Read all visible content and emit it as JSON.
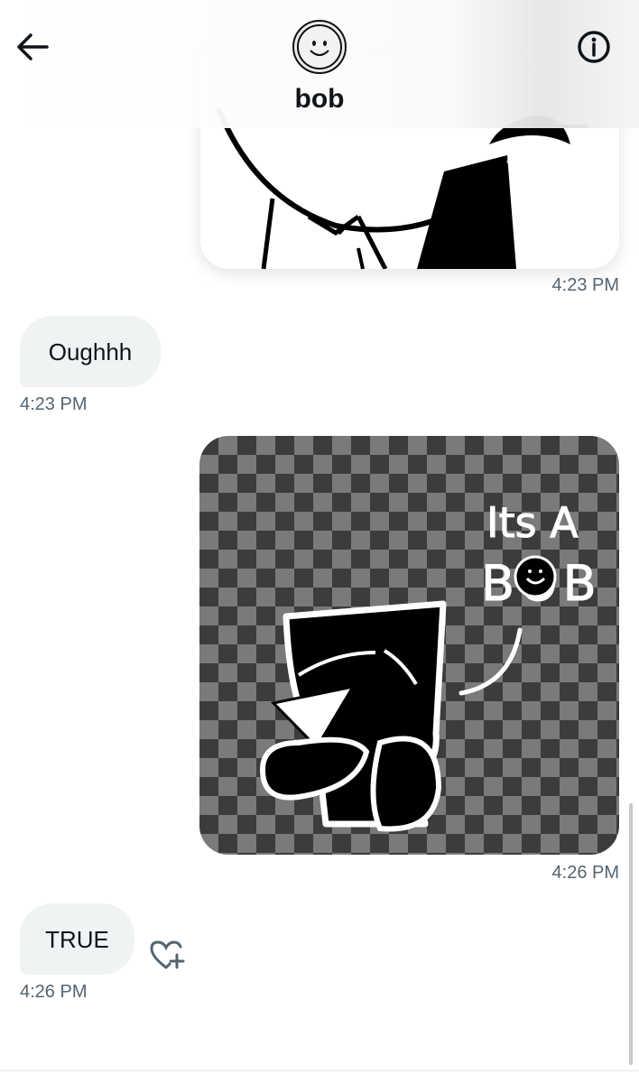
{
  "header": {
    "contact_name": "bob",
    "back_icon": "arrow-left-icon",
    "info_icon": "info-icon"
  },
  "messages": [
    {
      "type": "image",
      "side": "right",
      "description_icon": "bob-drawing",
      "timestamp": "4:23 PM"
    },
    {
      "type": "text",
      "side": "left",
      "text": "Oughhh",
      "timestamp": "4:23 PM"
    },
    {
      "type": "image",
      "side": "right",
      "timestamp": "4:26 PM",
      "image_text_line1": "Its A",
      "image_text_line2": "BOB"
    },
    {
      "type": "text",
      "side": "left",
      "text": "TRUE",
      "timestamp": "4:26 PM",
      "reaction_icon": "heart-plus-icon"
    }
  ],
  "colors": {
    "bubble_bg": "#eff3f4",
    "timestamp": "#536471",
    "text": "#0f1419"
  }
}
